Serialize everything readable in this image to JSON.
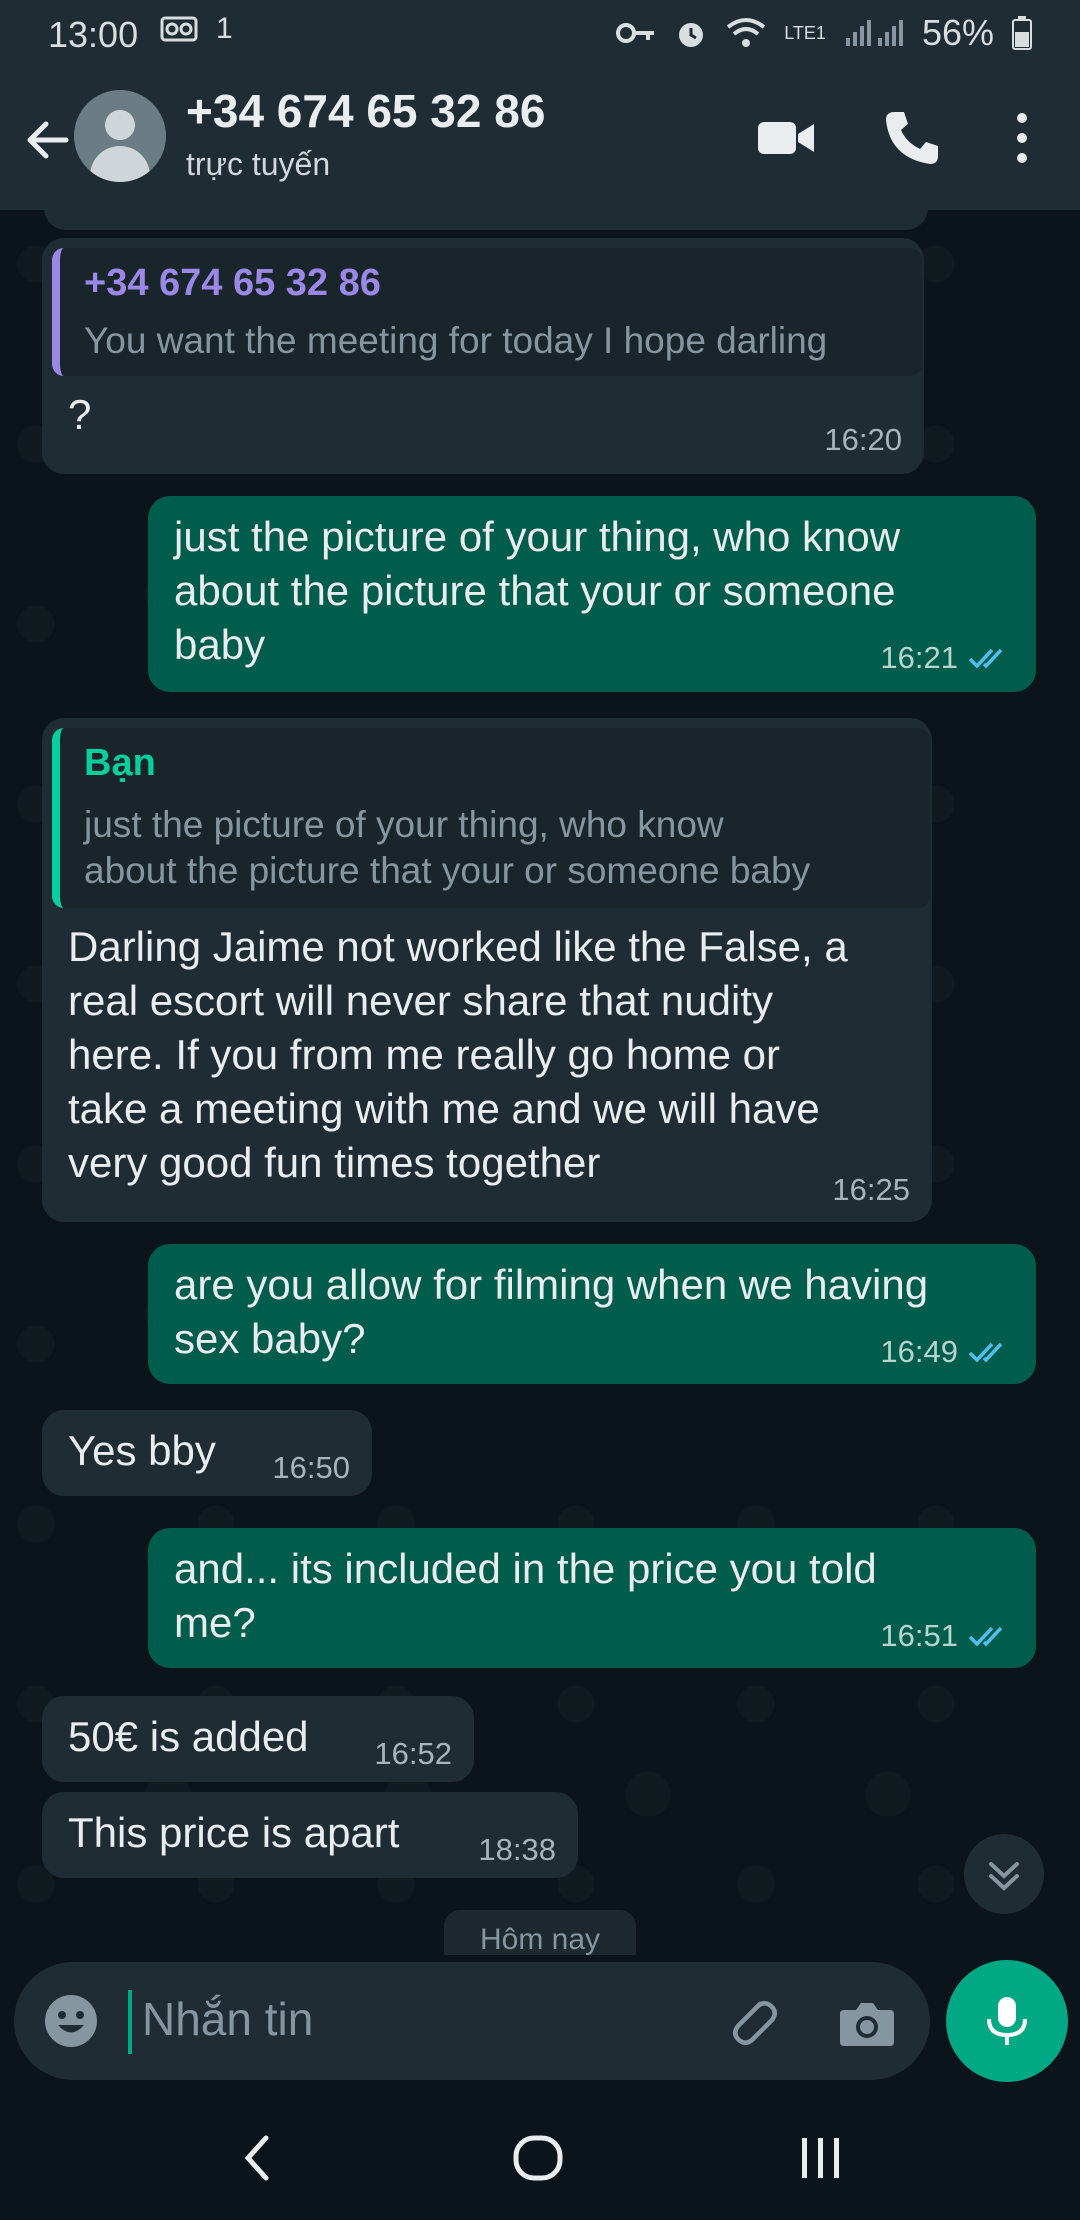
{
  "status_bar": {
    "time": "13:00",
    "sim_label": "1",
    "network_label": "LTE1",
    "battery": "56%"
  },
  "header": {
    "contact_name": "+34 674 65 32 86",
    "contact_status": "trực tuyến"
  },
  "messages": [
    {
      "direction": "in",
      "quoted": {
        "author": "+34 674 65 32 86",
        "text": "You want the meeting for today I hope darling"
      },
      "text": "?",
      "time": "16:20"
    },
    {
      "direction": "out",
      "lines": [
        "just the picture of your thing,  who know",
        "about the picture that your or someone",
        "baby"
      ],
      "time": "16:21",
      "read": true
    },
    {
      "direction": "in",
      "quoted": {
        "author": "Bạn",
        "lines": [
          "just the picture of your thing,  who know",
          "about the picture that your or someone baby"
        ]
      },
      "lines": [
        "Darling Jaime not worked like the False, a",
        "real escort will never share that nudity",
        "here. If you from me really go home or",
        "take a meeting with me and we will have",
        "very good fun times together"
      ],
      "time": "16:25"
    },
    {
      "direction": "out",
      "lines": [
        "are you allow for filming when we having",
        "sex baby?"
      ],
      "time": "16:49",
      "read": true
    },
    {
      "direction": "in",
      "text": "Yes bby",
      "time": "16:50"
    },
    {
      "direction": "out",
      "lines": [
        "and... its included in the price you told",
        "me?"
      ],
      "time": "16:51",
      "read": true
    },
    {
      "direction": "in",
      "text": "50€ is added",
      "time": "16:52"
    },
    {
      "direction": "in",
      "text": "This price is apart",
      "time": "18:38"
    }
  ],
  "date_chip": "Hôm nay",
  "composer": {
    "placeholder": "Nhắn tin"
  },
  "colors": {
    "incoming_bubble": "#202c33",
    "outgoing_bubble": "#005c4b",
    "accent": "#00a884",
    "read_ticks": "#53bdeb"
  }
}
